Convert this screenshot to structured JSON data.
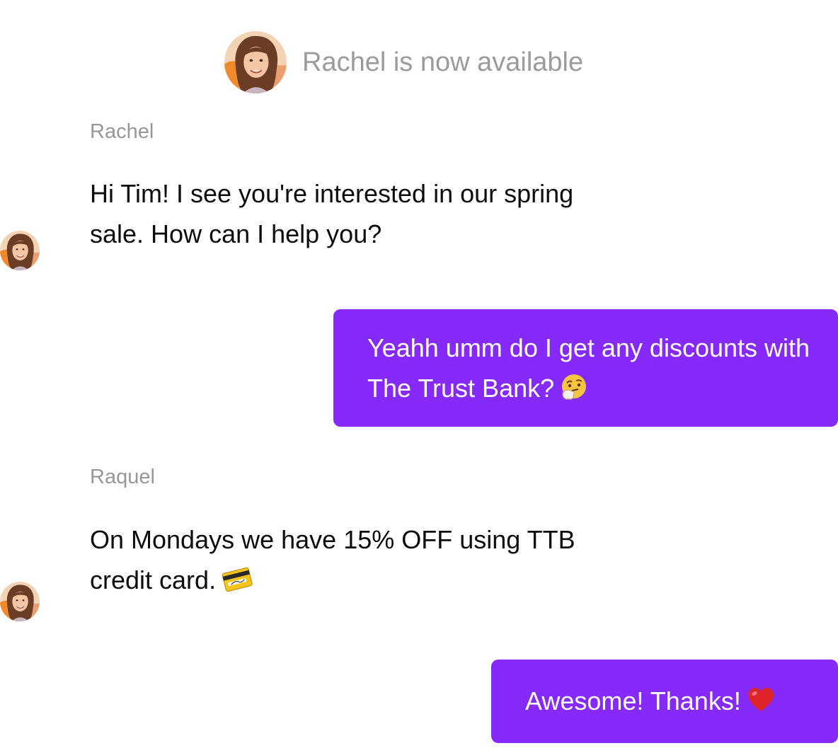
{
  "status": {
    "text": "Rachel is now available",
    "avatar": "agent-avatar-photo"
  },
  "messages": [
    {
      "from": "agent",
      "sender_name": "Rachel",
      "text": "Hi Tim! I see you're interested in our spring sale. How can I help you?"
    },
    {
      "from": "user",
      "text": "Yeahh umm do I get any discounts with The Trust Bank?",
      "emoji": "thinking-face-emoji"
    },
    {
      "from": "agent",
      "sender_name": "Raquel",
      "text": "On Mondays we have 15% OFF using TTB credit card.",
      "emoji": "credit-card-emoji"
    },
    {
      "from": "user",
      "text": "Awesome! Thanks!",
      "emoji": "red-heart-emoji"
    }
  ],
  "colors": {
    "user_bubble": "#8629fb",
    "user_text": "#ffffff",
    "agent_text": "#0d0d0d",
    "muted_text": "#9b9b9b"
  }
}
